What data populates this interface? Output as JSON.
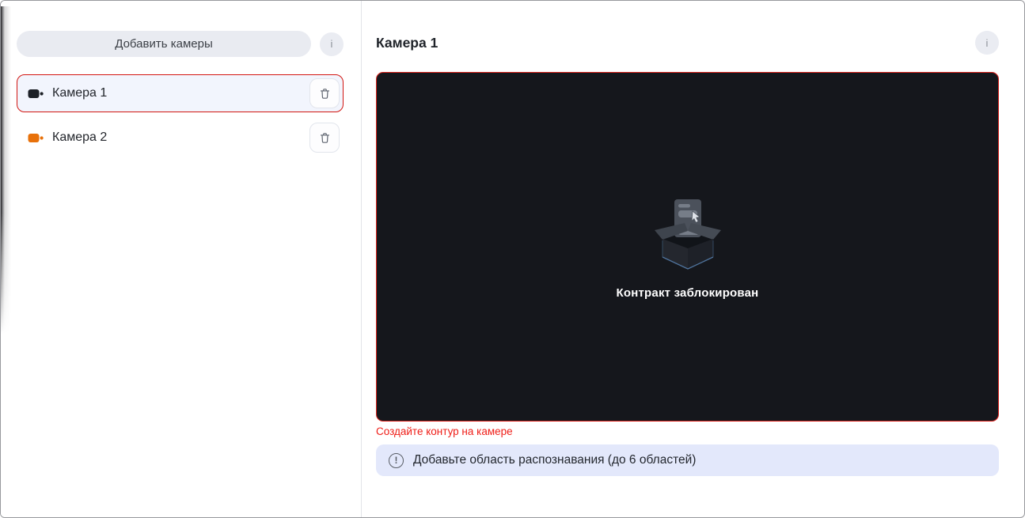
{
  "colors": {
    "accent_red": "#d21510",
    "selected_row_bg": "#f2f5fd",
    "video_bg": "#15171c",
    "banner_bg": "#e3e8fb",
    "camera1_icon_color": "#1d2127",
    "camera2_icon_color": "#e8710a"
  },
  "sidebar": {
    "add_button_label": "Добавить камеры",
    "info_glyph": "i",
    "cameras": [
      {
        "label": "Камера 1",
        "selected": true
      },
      {
        "label": "Камера 2",
        "selected": false
      }
    ]
  },
  "main": {
    "title": "Камера 1",
    "info_glyph": "i",
    "placeholder": {
      "message": "Контракт заблокирован"
    },
    "error_text": "Создайте контур на камере",
    "banner": {
      "icon_glyph": "!",
      "text": "Добавьте область распознавания (до 6 областей)"
    }
  }
}
